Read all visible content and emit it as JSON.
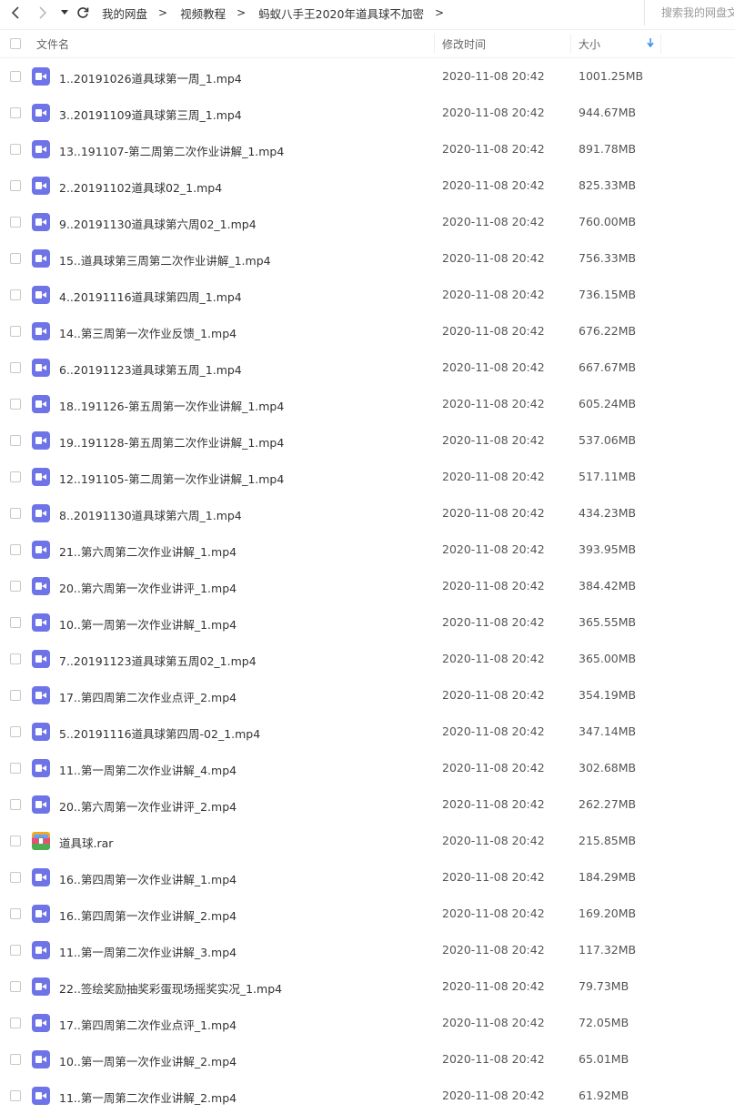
{
  "nav": {
    "back_icon": "chevron-left-icon",
    "forward_icon": "chevron-right-icon",
    "dropdown_icon": "caret-down-icon",
    "refresh_icon": "refresh-icon"
  },
  "breadcrumb": [
    "我的网盘",
    "视频教程",
    "蚂蚁八手王2020年道具球不加密"
  ],
  "breadcrumb_sep": ">",
  "search": {
    "placeholder": "搜索我的网盘文件"
  },
  "header": {
    "name": "文件名",
    "time": "修改时间",
    "size": "大小",
    "sort_icon": "arrow-down-icon"
  },
  "accent_color": "#3b8cf5",
  "files": [
    {
      "name": "1..20191026道具球第一周_1.mp4",
      "time": "2020-11-08 20:42",
      "size": "1001.25MB",
      "type": "video"
    },
    {
      "name": "3..20191109道具球第三周_1.mp4",
      "time": "2020-11-08 20:42",
      "size": "944.67MB",
      "type": "video"
    },
    {
      "name": "13..191107-第二周第二次作业讲解_1.mp4",
      "time": "2020-11-08 20:42",
      "size": "891.78MB",
      "type": "video"
    },
    {
      "name": "2..20191102道具球02_1.mp4",
      "time": "2020-11-08 20:42",
      "size": "825.33MB",
      "type": "video"
    },
    {
      "name": "9..20191130道具球第六周02_1.mp4",
      "time": "2020-11-08 20:42",
      "size": "760.00MB",
      "type": "video"
    },
    {
      "name": "15..道具球第三周第二次作业讲解_1.mp4",
      "time": "2020-11-08 20:42",
      "size": "756.33MB",
      "type": "video"
    },
    {
      "name": "4..20191116道具球第四周_1.mp4",
      "time": "2020-11-08 20:42",
      "size": "736.15MB",
      "type": "video"
    },
    {
      "name": "14..第三周第一次作业反馈_1.mp4",
      "time": "2020-11-08 20:42",
      "size": "676.22MB",
      "type": "video"
    },
    {
      "name": "6..20191123道具球第五周_1.mp4",
      "time": "2020-11-08 20:42",
      "size": "667.67MB",
      "type": "video"
    },
    {
      "name": "18..191126-第五周第一次作业讲解_1.mp4",
      "time": "2020-11-08 20:42",
      "size": "605.24MB",
      "type": "video"
    },
    {
      "name": "19..191128-第五周第二次作业讲解_1.mp4",
      "time": "2020-11-08 20:42",
      "size": "537.06MB",
      "type": "video"
    },
    {
      "name": "12..191105-第二周第一次作业讲解_1.mp4",
      "time": "2020-11-08 20:42",
      "size": "517.11MB",
      "type": "video"
    },
    {
      "name": "8..20191130道具球第六周_1.mp4",
      "time": "2020-11-08 20:42",
      "size": "434.23MB",
      "type": "video"
    },
    {
      "name": "21..第六周第二次作业讲解_1.mp4",
      "time": "2020-11-08 20:42",
      "size": "393.95MB",
      "type": "video"
    },
    {
      "name": "20..第六周第一次作业讲评_1.mp4",
      "time": "2020-11-08 20:42",
      "size": "384.42MB",
      "type": "video"
    },
    {
      "name": "10..第一周第一次作业讲解_1.mp4",
      "time": "2020-11-08 20:42",
      "size": "365.55MB",
      "type": "video"
    },
    {
      "name": "7..20191123道具球第五周02_1.mp4",
      "time": "2020-11-08 20:42",
      "size": "365.00MB",
      "type": "video"
    },
    {
      "name": "17..第四周第二次作业点评_2.mp4",
      "time": "2020-11-08 20:42",
      "size": "354.19MB",
      "type": "video"
    },
    {
      "name": "5..20191116道具球第四周-02_1.mp4",
      "time": "2020-11-08 20:42",
      "size": "347.14MB",
      "type": "video"
    },
    {
      "name": "11..第一周第二次作业讲解_4.mp4",
      "time": "2020-11-08 20:42",
      "size": "302.68MB",
      "type": "video"
    },
    {
      "name": "20..第六周第一次作业讲评_2.mp4",
      "time": "2020-11-08 20:42",
      "size": "262.27MB",
      "type": "video"
    },
    {
      "name": "道具球.rar",
      "time": "2020-11-08 20:42",
      "size": "215.85MB",
      "type": "archive"
    },
    {
      "name": "16..第四周第一次作业讲解_1.mp4",
      "time": "2020-11-08 20:42",
      "size": "184.29MB",
      "type": "video"
    },
    {
      "name": "16..第四周第一次作业讲解_2.mp4",
      "time": "2020-11-08 20:42",
      "size": "169.20MB",
      "type": "video"
    },
    {
      "name": "11..第一周第二次作业讲解_3.mp4",
      "time": "2020-11-08 20:42",
      "size": "117.32MB",
      "type": "video"
    },
    {
      "name": "22..签绘奖励抽奖彩蛋现场摇奖实况_1.mp4",
      "time": "2020-11-08 20:42",
      "size": "79.73MB",
      "type": "video"
    },
    {
      "name": "17..第四周第二次作业点评_1.mp4",
      "time": "2020-11-08 20:42",
      "size": "72.05MB",
      "type": "video"
    },
    {
      "name": "10..第一周第一次作业讲解_2.mp4",
      "time": "2020-11-08 20:42",
      "size": "65.01MB",
      "type": "video"
    },
    {
      "name": "11..第一周第二次作业讲解_2.mp4",
      "time": "2020-11-08 20:42",
      "size": "61.92MB",
      "type": "video"
    }
  ]
}
